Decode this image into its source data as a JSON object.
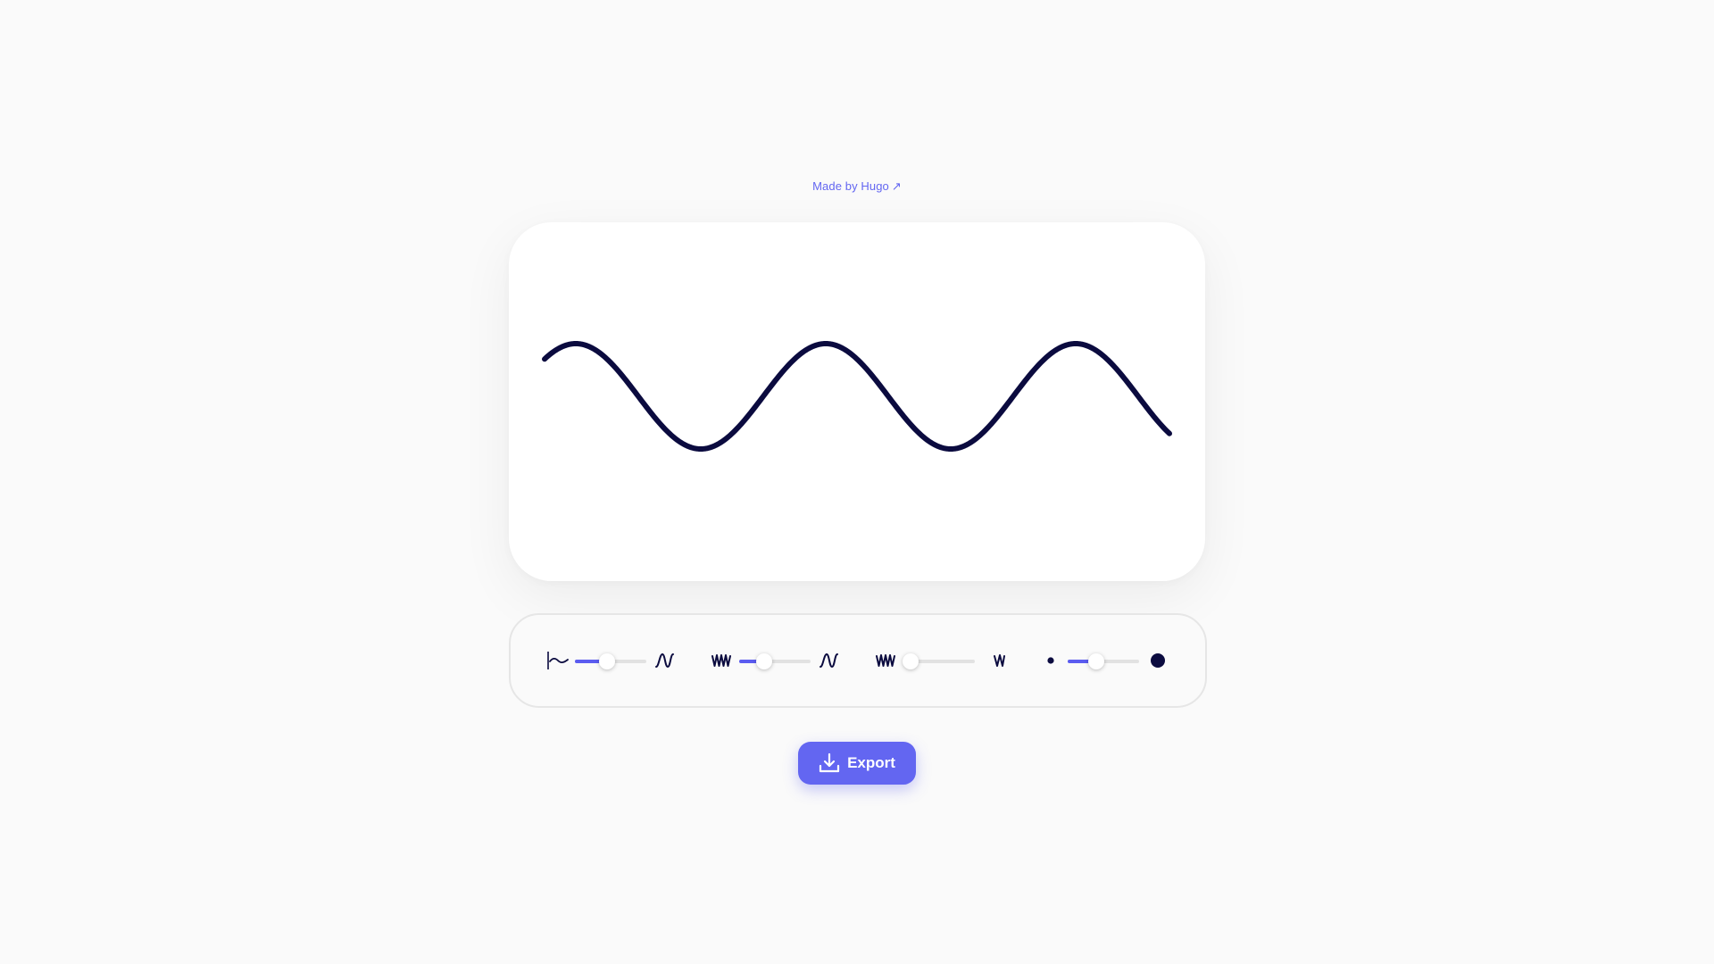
{
  "header": {
    "made_by_label": "Made by Hugo",
    "made_by_arrow": "↗"
  },
  "wave": {
    "stroke_color": "#0b0b3f",
    "amplitude": 0.5,
    "cycles": 2.5,
    "phase_deg": 45,
    "stroke_level": 0.4
  },
  "controls": {
    "sliders": [
      {
        "name": "amplitude",
        "min_icon": "flat-wave-icon",
        "max_icon": "tall-wave-icon",
        "value": 0.45
      },
      {
        "name": "frequency",
        "min_icon": "dense-wave-icon",
        "max_icon": "sparse-wave-icon",
        "value": 0.35
      },
      {
        "name": "phase",
        "min_icon": "dense-wave-icon",
        "max_icon": "narrow-wave-icon",
        "value": 0.1
      },
      {
        "name": "thickness",
        "min_icon": "small-dot-icon",
        "max_icon": "large-dot-icon",
        "value": 0.4
      }
    ],
    "accent_color": "#5b5cf0",
    "track_color": "#e2e2e2"
  },
  "export": {
    "label": "Export",
    "icon": "download-icon",
    "color": "#6366f1"
  }
}
